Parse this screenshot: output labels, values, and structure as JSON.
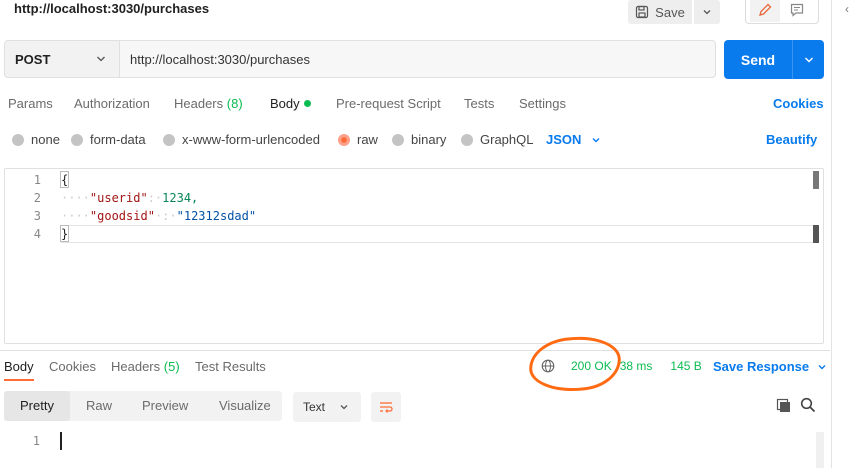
{
  "request_title": "http://localhost:3030/purchases",
  "toolbar": {
    "save_label": "Save"
  },
  "request": {
    "method": "POST",
    "url": "http://localhost:3030/purchases",
    "send_label": "Send"
  },
  "request_tabs": {
    "params": "Params",
    "authorization": "Authorization",
    "headers": "Headers",
    "headers_count": "(8)",
    "body": "Body",
    "prerequest": "Pre-request Script",
    "tests": "Tests",
    "settings": "Settings",
    "cookies": "Cookies"
  },
  "body_types": {
    "none": "none",
    "form_data": "form-data",
    "urlencoded": "x-www-form-urlencoded",
    "raw": "raw",
    "binary": "binary",
    "graphql": "GraphQL",
    "selected": "raw",
    "format": "JSON",
    "beautify": "Beautify"
  },
  "editor": {
    "line_numbers": [
      "1",
      "2",
      "3",
      "4"
    ],
    "open_brace": "{",
    "close_brace": "}",
    "indent": "····",
    "line2_key": "\"userid\"",
    "line2_sep": ":·",
    "line2_value": "1234,",
    "line3_key": "\"goodsid\"",
    "line3_sep": "·:·",
    "line3_value": "\"12312sdad\""
  },
  "response_tabs": {
    "body": "Body",
    "cookies": "Cookies",
    "headers": "Headers",
    "headers_count": "(5)",
    "test_results": "Test Results"
  },
  "response_status": {
    "code": "200 OK",
    "time": "38 ms",
    "size": "145 B",
    "save_response": "Save Response"
  },
  "view_tabs": {
    "pretty": "Pretty",
    "raw": "Raw",
    "preview": "Preview",
    "visualize": "Visualize",
    "text_format": "Text"
  },
  "response_body": {
    "line_numbers": [
      "1"
    ]
  },
  "colors": {
    "accent_blue": "#097bed",
    "status_green": "#0cbb52",
    "annotation_orange": "#ff6a13"
  }
}
